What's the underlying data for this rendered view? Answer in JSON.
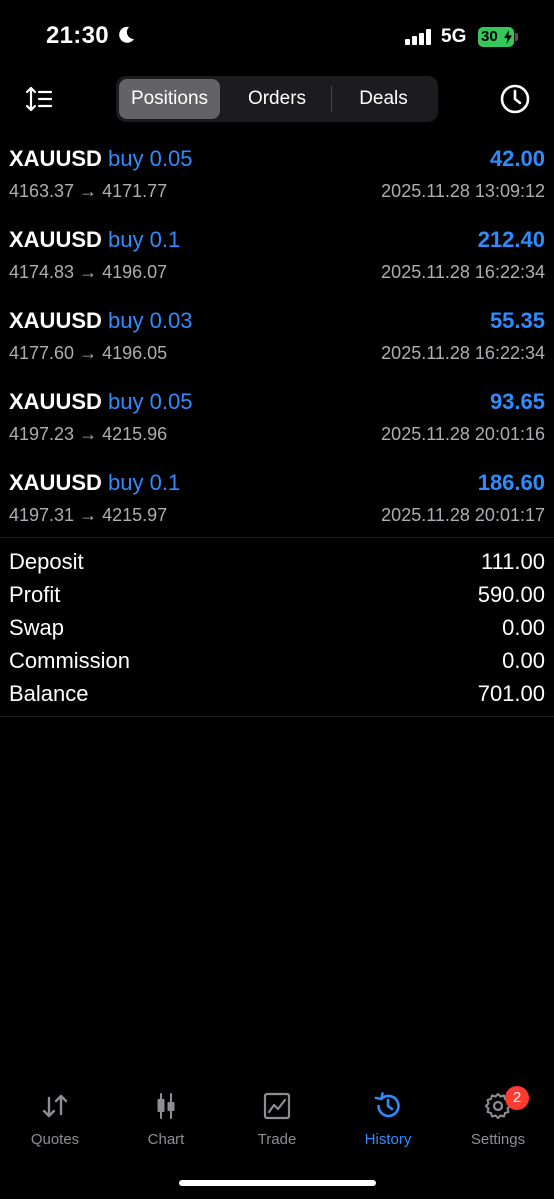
{
  "status": {
    "time": "21:30",
    "network": "5G",
    "battery": "30"
  },
  "toolbar": {
    "segments": [
      "Positions",
      "Orders",
      "Deals"
    ],
    "active_segment": "Positions"
  },
  "deals": [
    {
      "symbol": "XAUUSD",
      "direction": "buy",
      "volume": "0.05",
      "profit": "42.00",
      "prices": "4163.37 → 4171.77",
      "time": "2025.11.28 13:09:12"
    },
    {
      "symbol": "XAUUSD",
      "direction": "buy",
      "volume": "0.1",
      "profit": "212.40",
      "prices": "4174.83 → 4196.07",
      "time": "2025.11.28 16:22:34"
    },
    {
      "symbol": "XAUUSD",
      "direction": "buy",
      "volume": "0.03",
      "profit": "55.35",
      "prices": "4177.60 → 4196.05",
      "time": "2025.11.28 16:22:34"
    },
    {
      "symbol": "XAUUSD",
      "direction": "buy",
      "volume": "0.05",
      "profit": "93.65",
      "prices": "4197.23 → 4215.96",
      "time": "2025.11.28 20:01:16"
    },
    {
      "symbol": "XAUUSD",
      "direction": "buy",
      "volume": "0.1",
      "profit": "186.60",
      "prices": "4197.31 → 4215.97",
      "time": "2025.11.28 20:01:17"
    }
  ],
  "summary": [
    {
      "label": "Deposit",
      "value": "111.00"
    },
    {
      "label": "Profit",
      "value": "590.00"
    },
    {
      "label": "Swap",
      "value": "0.00"
    },
    {
      "label": "Commission",
      "value": "0.00"
    },
    {
      "label": "Balance",
      "value": "701.00"
    }
  ],
  "tabbar": {
    "tabs": [
      {
        "label": "Quotes",
        "icon": "quotes-arrows-icon"
      },
      {
        "label": "Chart",
        "icon": "candlestick-icon"
      },
      {
        "label": "Trade",
        "icon": "trade-chart-icon"
      },
      {
        "label": "History",
        "icon": "history-icon"
      },
      {
        "label": "Settings",
        "icon": "gear-icon"
      }
    ],
    "active_tab": "History",
    "settings_badge": "2"
  },
  "colors": {
    "accent": "#2f8cff",
    "badge": "#ff3b30",
    "battery": "#34c759"
  }
}
